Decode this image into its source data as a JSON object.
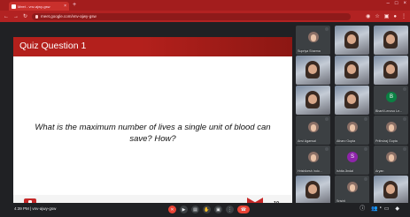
{
  "browser": {
    "tab_title": "Meet - vnv-ajwy-gsw",
    "new_tab_icon": "plus-icon",
    "url": "meet.google.com/vnv-ajwy-gsw"
  },
  "slide": {
    "title": "Quiz Question 1",
    "question": "What is the maximum number of lives a single unit of blood can save? How?",
    "slide_number": "10",
    "brand_color": "#b3201c"
  },
  "participants": [
    {
      "name": "Supriya Sharma",
      "kind": "avatar",
      "initial": ""
    },
    {
      "name": "",
      "kind": "video"
    },
    {
      "name": "",
      "kind": "video"
    },
    {
      "name": "",
      "kind": "video"
    },
    {
      "name": "",
      "kind": "video"
    },
    {
      "name": "",
      "kind": "video"
    },
    {
      "name": "",
      "kind": "video"
    },
    {
      "name": "",
      "kind": "video"
    },
    {
      "name": "Bharti Lenovo Le...",
      "kind": "avatar",
      "initial": "B",
      "color": "#0b8043"
    },
    {
      "name": "Anvi Agarwal",
      "kind": "avatar",
      "initial": ""
    },
    {
      "name": "Atharv Gupta",
      "kind": "avatar",
      "initial": ""
    },
    {
      "name": "Prithviraj Gupta",
      "kind": "avatar",
      "initial": ""
    },
    {
      "name": "Hrishikesh Indo...",
      "kind": "avatar",
      "initial": ""
    },
    {
      "name": "Ishita Jindal",
      "kind": "avatar",
      "initial": "S",
      "color": "#8e24aa"
    },
    {
      "name": "Aryan",
      "kind": "avatar",
      "initial": ""
    },
    {
      "name": "",
      "kind": "video"
    },
    {
      "name": "Srishti",
      "kind": "avatar",
      "initial": ""
    },
    {
      "name": "",
      "kind": "video"
    }
  ],
  "callbar": {
    "meeting_info": "4:39 PM  |  vnv-ajwy-gsw",
    "end_call_color": "#ea4335"
  }
}
